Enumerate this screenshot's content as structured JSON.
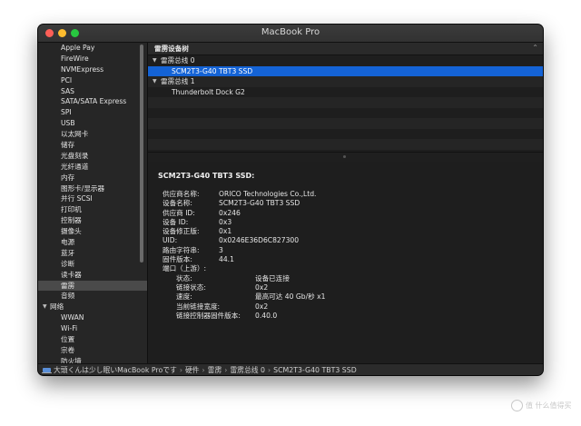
{
  "window": {
    "title": "MacBook Pro"
  },
  "sidebar": {
    "items": [
      "Apple Pay",
      "FireWire",
      "NVMExpress",
      "PCI",
      "SAS",
      "SATA/SATA Express",
      "SPI",
      "USB",
      "以太网卡",
      "储存",
      "光盘刻录",
      "光纤通道",
      "内存",
      "图形卡/显示器",
      "并行 SCSI",
      "打印机",
      "控制器",
      "摄像头",
      "电源",
      "蓝牙",
      "诊断",
      "读卡器",
      "雷雳",
      "音频"
    ],
    "selected": "雷雳",
    "network_group": "网络",
    "network_items": [
      "WWAN",
      "Wi-Fi",
      "位置",
      "宗卷",
      "防火墙"
    ]
  },
  "tree": {
    "header": "雷雳设备树",
    "bus0": "雷雳总线 0",
    "bus0_device": "SCM2T3-G40 TBT3 SSD",
    "bus1": "雷雳总线 1",
    "bus1_device": "Thunderbolt Dock G2"
  },
  "detail": {
    "title": "SCM2T3-G40 TBT3 SSD:",
    "fields": [
      {
        "label": "供应商名称:",
        "value": "ORICO Technologies Co.,Ltd."
      },
      {
        "label": "设备名称:",
        "value": "SCM2T3-G40 TBT3 SSD"
      },
      {
        "label": "供应商 ID:",
        "value": "0x246"
      },
      {
        "label": "设备 ID:",
        "value": "0x3"
      },
      {
        "label": "设备修正版:",
        "value": "0x1"
      },
      {
        "label": "UID:",
        "value": "0x0246E36D6C827300"
      },
      {
        "label": "路由字符串:",
        "value": "3"
      },
      {
        "label": "固件版本:",
        "value": "44.1"
      }
    ],
    "port_label": "端口（上游）:",
    "port_fields": [
      {
        "label": "状态:",
        "value": "设备已连接"
      },
      {
        "label": "链接状态:",
        "value": "0x2"
      },
      {
        "label": "速度:",
        "value": "最高可达 40 Gb/秒 x1"
      },
      {
        "label": "当前链接宽度:",
        "value": "0x2"
      },
      {
        "label": "链接控制器固件版本:",
        "value": "0.40.0"
      }
    ]
  },
  "statusbar": {
    "crumbs": [
      "大頭くんは少し眠いMacBook Proです",
      "硬件",
      "雷雳",
      "雷雳总线 0",
      "SCM2T3-G40 TBT3 SSD"
    ]
  },
  "watermark": "值 什么值得买",
  "colors": {
    "selection": "#1463d6",
    "window_bg": "#1e1e1e"
  }
}
